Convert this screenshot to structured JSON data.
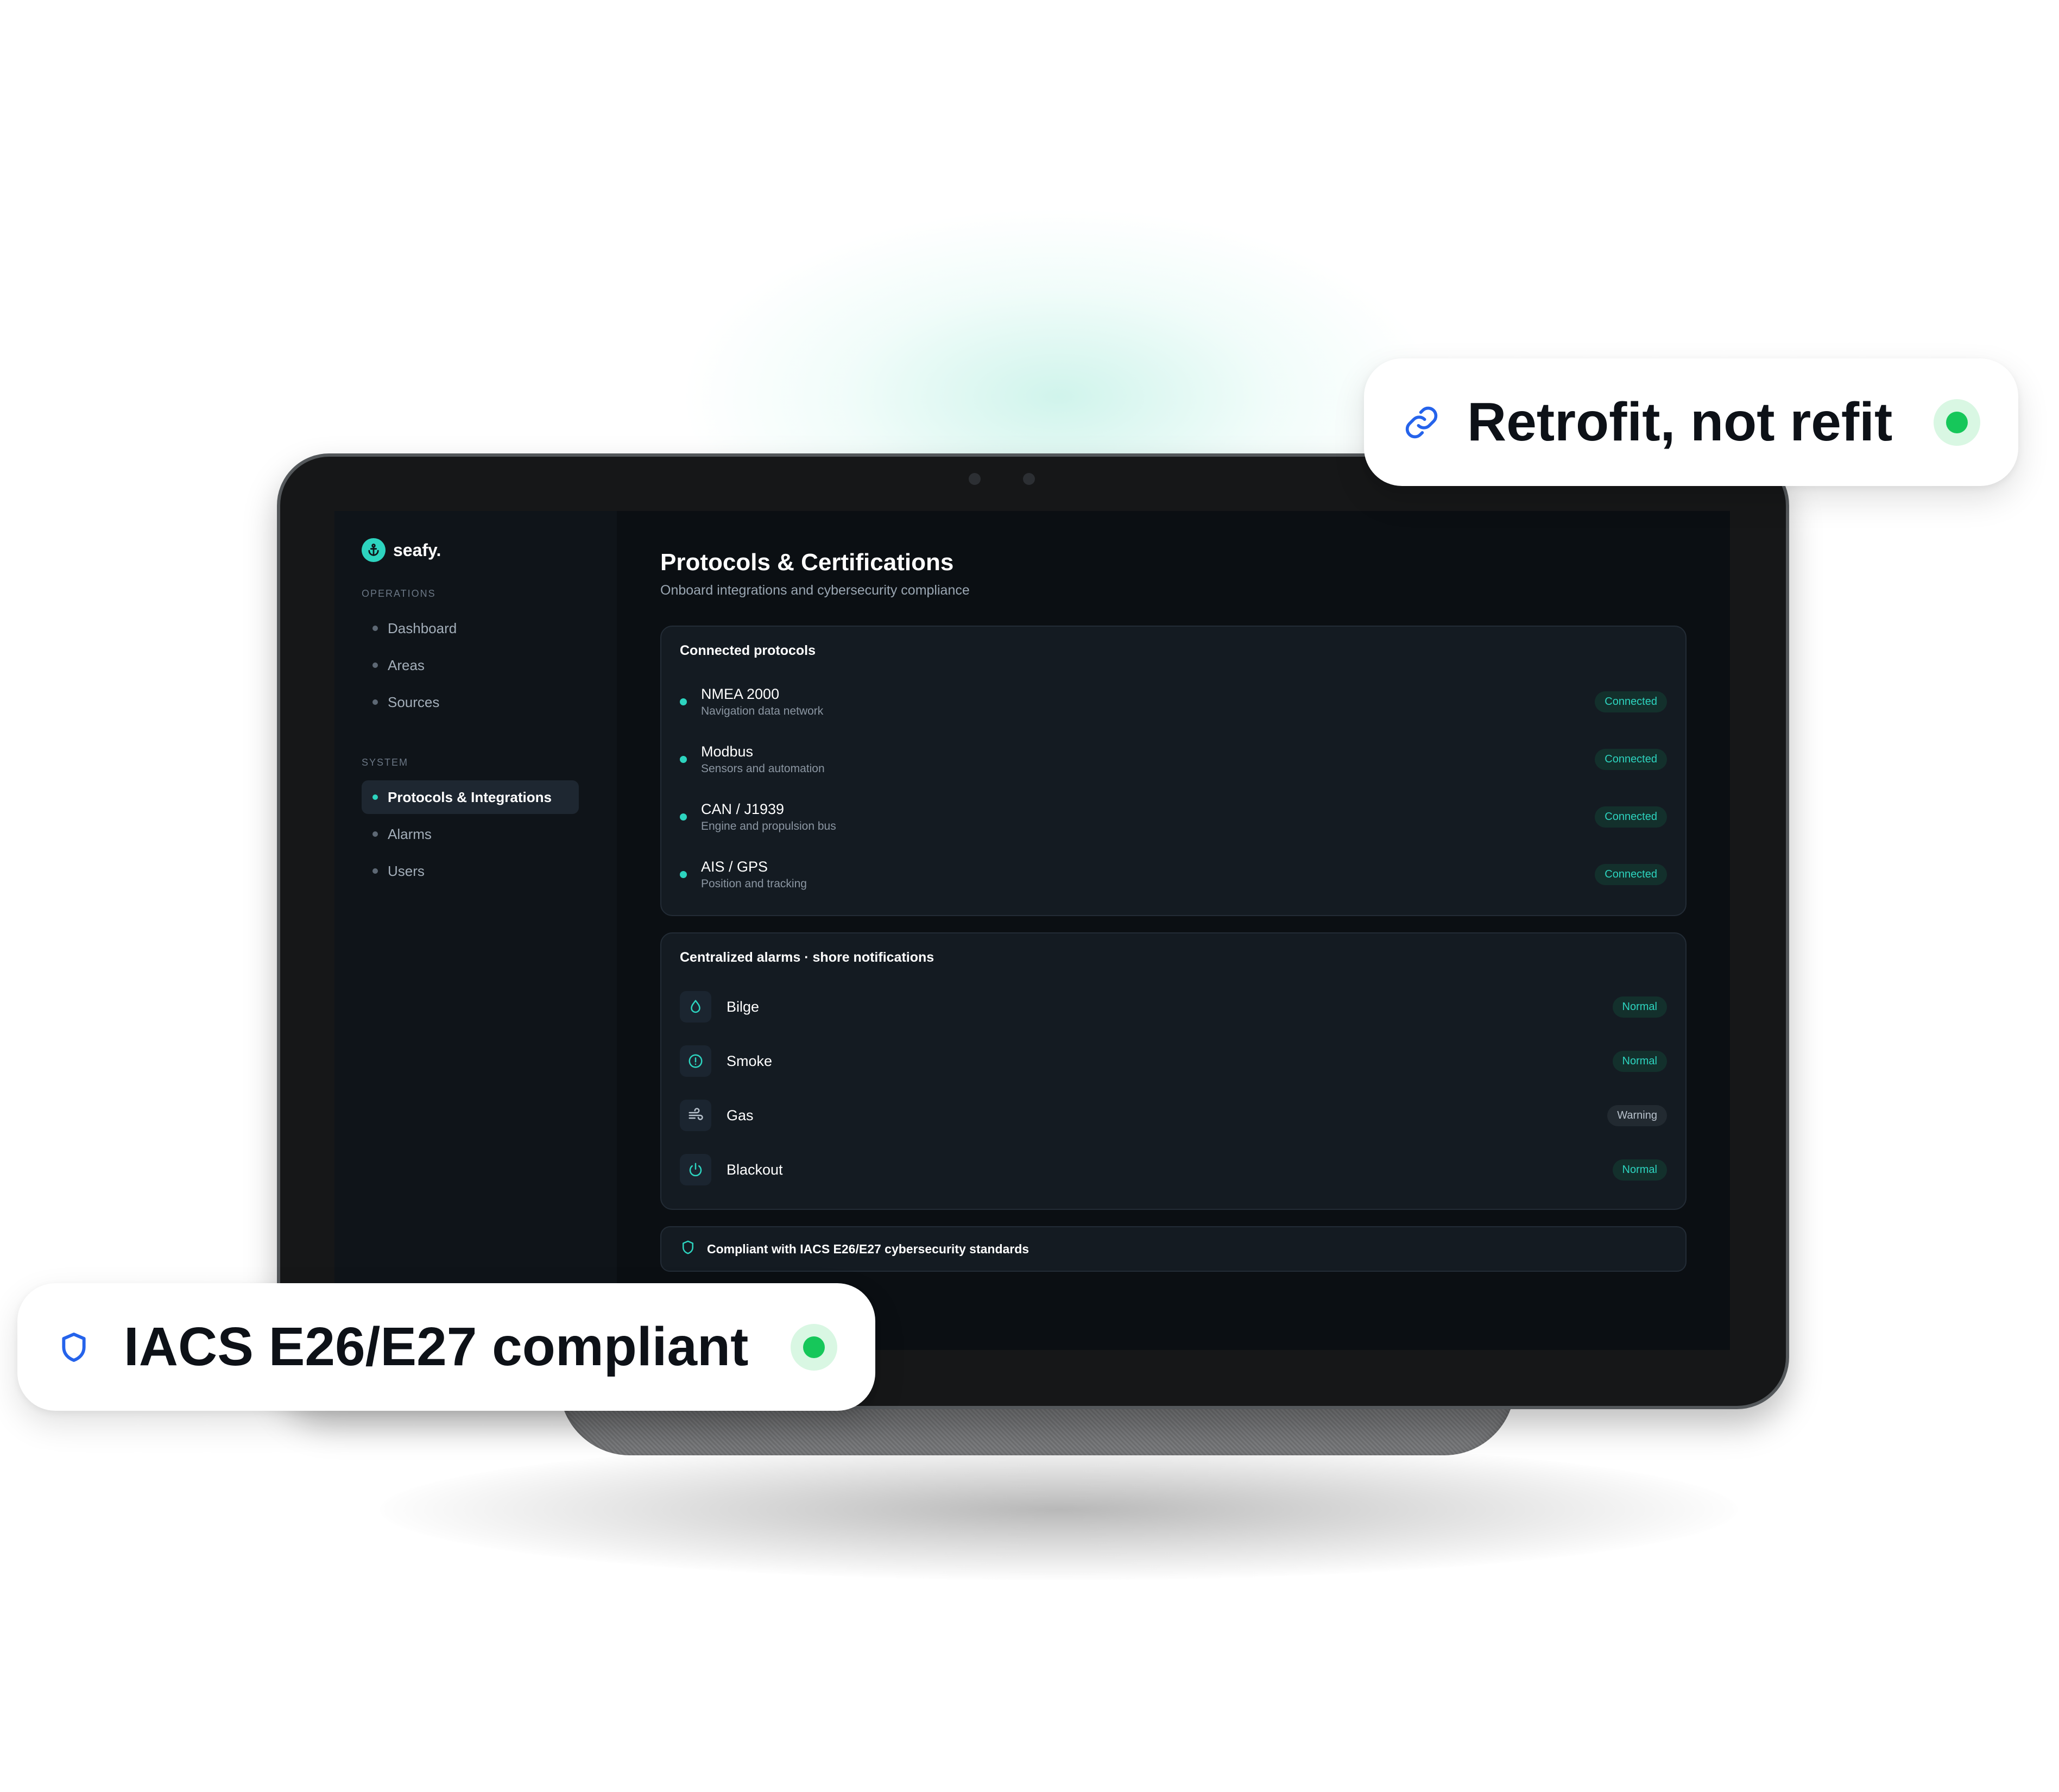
{
  "colors": {
    "accent": "#2dd4bf",
    "brand_blue": "#2563eb",
    "status_green": "#16c75a"
  },
  "badges": {
    "retrofit": {
      "text": "Retrofit, not refit",
      "icon": "link-icon"
    },
    "compliance": {
      "text": "IACS E26/E27 compliant",
      "icon": "shield-icon"
    }
  },
  "sidebar": {
    "brand": "seafy.",
    "operations_label": "OPERATIONS",
    "operations": [
      "Dashboard",
      "Areas",
      "Sources"
    ],
    "system_label": "SYSTEM",
    "system": [
      "Protocols & Integrations",
      "Alarms",
      "Users"
    ]
  },
  "main": {
    "title": "Protocols & Certifications",
    "subtitle": "Onboard integrations and cybersecurity compliance",
    "protocols": {
      "title": "Connected protocols",
      "items": [
        {
          "name": "NMEA 2000",
          "desc": "Navigation data network",
          "status": "Connected"
        },
        {
          "name": "Modbus",
          "desc": "Sensors and automation",
          "status": "Connected"
        },
        {
          "name": "CAN / J1939",
          "desc": "Engine and propulsion bus",
          "status": "Connected"
        },
        {
          "name": "AIS / GPS",
          "desc": "Position and tracking",
          "status": "Connected"
        }
      ]
    },
    "alarms": {
      "title": "Centralized alarms · shore notifications",
      "items": [
        {
          "name": "Bilge",
          "status": "Normal",
          "icon": "droplet-icon"
        },
        {
          "name": "Smoke",
          "status": "Normal",
          "icon": "alert-circle-icon"
        },
        {
          "name": "Gas",
          "status": "Warning",
          "icon": "wind-icon"
        },
        {
          "name": "Blackout",
          "status": "Normal",
          "icon": "power-icon"
        }
      ]
    },
    "compliance": "Compliant with IACS E26/E27 cybersecurity standards"
  }
}
